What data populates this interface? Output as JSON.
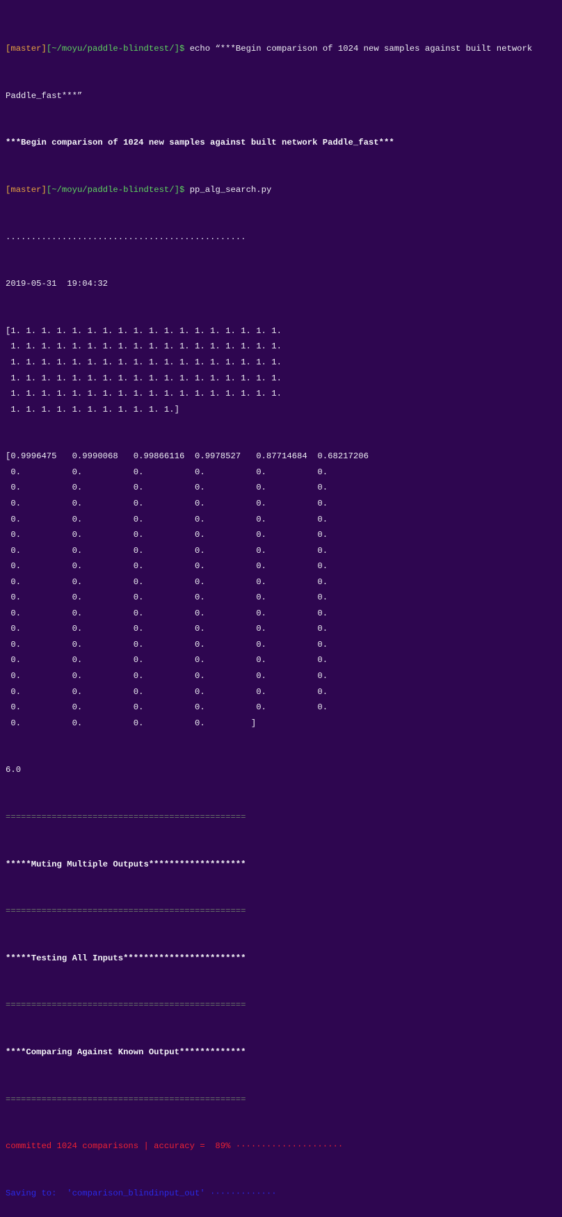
{
  "prompt": {
    "branch": "master",
    "path": "~/moyu/paddle-blindtest/",
    "symbol": "$"
  },
  "commands": [
    "echo “***Begin comparison of 1024 new samples against built network",
    "pp_alg_search.py"
  ],
  "echo_continuation": "Paddle_fast***”",
  "echo_output": "***Begin comparison of 1024 new samples against built network Paddle_fast***",
  "progress_dots": "...............................................",
  "timestamp": "2019-05-31  19:04:32",
  "ones_rows": [
    "[1. 1. 1. 1. 1. 1. 1. 1. 1. 1. 1. 1. 1. 1. 1. 1. 1. 1.",
    " 1. 1. 1. 1. 1. 1. 1. 1. 1. 1. 1. 1. 1. 1. 1. 1. 1. 1.",
    " 1. 1. 1. 1. 1. 1. 1. 1. 1. 1. 1. 1. 1. 1. 1. 1. 1. 1.",
    " 1. 1. 1. 1. 1. 1. 1. 1. 1. 1. 1. 1. 1. 1. 1. 1. 1. 1.",
    " 1. 1. 1. 1. 1. 1. 1. 1. 1. 1. 1. 1. 1. 1. 1. 1. 1. 1.",
    " 1. 1. 1. 1. 1. 1. 1. 1. 1. 1. 1.]"
  ],
  "prob_rows": [
    "[0.9996475   0.9990068   0.99866116  0.9978527   0.87714684  0.68217206",
    " 0.          0.          0.          0.          0.          0.",
    " 0.          0.          0.          0.          0.          0.",
    " 0.          0.          0.          0.          0.          0.",
    " 0.          0.          0.          0.          0.          0.",
    " 0.          0.          0.          0.          0.          0.",
    " 0.          0.          0.          0.          0.          0.",
    " 0.          0.          0.          0.          0.          0.",
    " 0.          0.          0.          0.          0.          0.",
    " 0.          0.          0.          0.          0.          0.",
    " 0.          0.          0.          0.          0.          0.",
    " 0.          0.          0.          0.          0.          0.",
    " 0.          0.          0.          0.          0.          0.",
    " 0.          0.          0.          0.          0.          0.",
    " 0.          0.          0.          0.          0.          0.",
    " 0.          0.          0.          0.          0.          0.",
    " 0.          0.          0.          0.          0.          0.",
    " 0.          0.          0.          0.         ]"
  ],
  "score": "6.0",
  "separator": "===============================================",
  "headers": [
    "*****Muting Multiple Outputs*******************",
    "*****Testing All Inputs************************",
    "****Comparing Against Known Output*************"
  ],
  "result_line": "committed 1024 comparisons | accuracy =  89% ·····················",
  "saving_line": "Saving to:  'comparison_blindinput_out' ·············"
}
